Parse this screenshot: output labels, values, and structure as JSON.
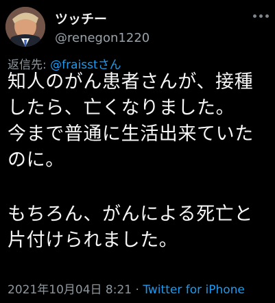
{
  "tweet": {
    "display_name": "ツッチー",
    "handle": "@renegon1220",
    "reply_prefix": "返信先:",
    "reply_mention": "@fraisstさん",
    "body_lines": [
      "知人のがん患者さんが、接種",
      "したら、亡くなりました。",
      "今まで普通に生活出来ていた",
      "のに。",
      "",
      "もちろん、がんによる死亡と",
      "片付けられました。"
    ],
    "timestamp": "2021年10月04日 8:21",
    "separator": " · ",
    "source": "Twitter for iPhone"
  },
  "icons": {
    "avatar": "profile-avatar",
    "menu": "more-options-icon"
  },
  "colors": {
    "background": "#000000",
    "text": "#e7e9ea",
    "secondary": "#8f989f",
    "accent": "#1d9bf0"
  }
}
